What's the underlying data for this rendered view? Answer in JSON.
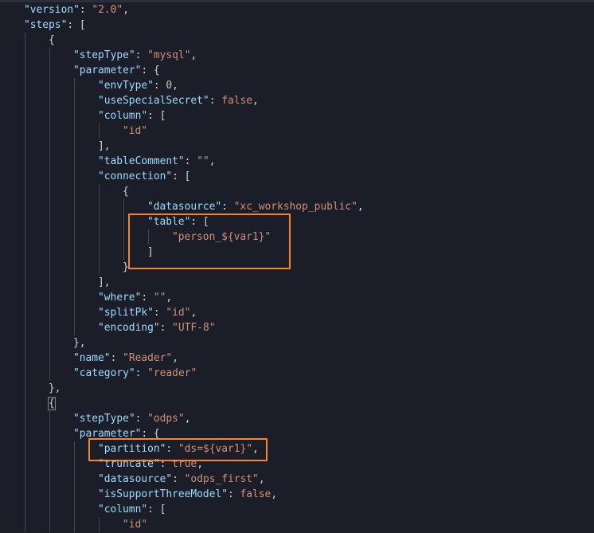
{
  "editor": {
    "lines": [
      {
        "indent": 1,
        "tokens": [
          [
            "k",
            "\"version\""
          ],
          [
            "p",
            ": "
          ],
          [
            "s",
            "\"2.0\""
          ],
          [
            "p",
            ","
          ]
        ]
      },
      {
        "indent": 1,
        "tokens": [
          [
            "k",
            "\"steps\""
          ],
          [
            "p",
            ": ["
          ]
        ]
      },
      {
        "indent": 2,
        "tokens": [
          [
            "p",
            "{"
          ]
        ]
      },
      {
        "indent": 3,
        "tokens": [
          [
            "k",
            "\"stepType\""
          ],
          [
            "p",
            ": "
          ],
          [
            "s",
            "\"mysql\""
          ],
          [
            "p",
            ","
          ]
        ]
      },
      {
        "indent": 3,
        "tokens": [
          [
            "k",
            "\"parameter\""
          ],
          [
            "p",
            ": {"
          ]
        ]
      },
      {
        "indent": 4,
        "tokens": [
          [
            "k",
            "\"envType\""
          ],
          [
            "p",
            ": "
          ],
          [
            "n",
            "0"
          ],
          [
            "p",
            ","
          ]
        ]
      },
      {
        "indent": 4,
        "tokens": [
          [
            "k",
            "\"useSpecialSecret\""
          ],
          [
            "p",
            ": "
          ],
          [
            "s",
            "false"
          ],
          [
            "p",
            ","
          ]
        ]
      },
      {
        "indent": 4,
        "tokens": [
          [
            "k",
            "\"column\""
          ],
          [
            "p",
            ": ["
          ]
        ]
      },
      {
        "indent": 5,
        "tokens": [
          [
            "s",
            "\"id\""
          ]
        ]
      },
      {
        "indent": 4,
        "tokens": [
          [
            "p",
            "],"
          ]
        ]
      },
      {
        "indent": 4,
        "tokens": [
          [
            "k",
            "\"tableComment\""
          ],
          [
            "p",
            ": "
          ],
          [
            "s",
            "\"\""
          ],
          [
            "p",
            ","
          ]
        ]
      },
      {
        "indent": 4,
        "tokens": [
          [
            "k",
            "\"connection\""
          ],
          [
            "p",
            ": ["
          ]
        ]
      },
      {
        "indent": 5,
        "tokens": [
          [
            "p",
            "{"
          ]
        ]
      },
      {
        "indent": 6,
        "tokens": [
          [
            "k",
            "\"datasource\""
          ],
          [
            "p",
            ": "
          ],
          [
            "s",
            "\"xc_workshop_public\""
          ],
          [
            "p",
            ","
          ]
        ]
      },
      {
        "indent": 6,
        "tokens": [
          [
            "k",
            "\"table\""
          ],
          [
            "p",
            ": ["
          ]
        ]
      },
      {
        "indent": 7,
        "tokens": [
          [
            "s",
            "\"person_${var1}\""
          ]
        ]
      },
      {
        "indent": 6,
        "tokens": [
          [
            "p",
            "]"
          ]
        ]
      },
      {
        "indent": 5,
        "tokens": [
          [
            "p",
            "}"
          ]
        ]
      },
      {
        "indent": 4,
        "tokens": [
          [
            "p",
            "],"
          ]
        ]
      },
      {
        "indent": 4,
        "tokens": [
          [
            "k",
            "\"where\""
          ],
          [
            "p",
            ": "
          ],
          [
            "s",
            "\"\""
          ],
          [
            "p",
            ","
          ]
        ]
      },
      {
        "indent": 4,
        "tokens": [
          [
            "k",
            "\"splitPk\""
          ],
          [
            "p",
            ": "
          ],
          [
            "s",
            "\"id\""
          ],
          [
            "p",
            ","
          ]
        ]
      },
      {
        "indent": 4,
        "tokens": [
          [
            "k",
            "\"encoding\""
          ],
          [
            "p",
            ": "
          ],
          [
            "s",
            "\"UTF-8\""
          ]
        ]
      },
      {
        "indent": 3,
        "tokens": [
          [
            "p",
            "},"
          ]
        ]
      },
      {
        "indent": 3,
        "tokens": [
          [
            "k",
            "\"name\""
          ],
          [
            "p",
            ": "
          ],
          [
            "s",
            "\"Reader\""
          ],
          [
            "p",
            ","
          ]
        ]
      },
      {
        "indent": 3,
        "tokens": [
          [
            "k",
            "\"category\""
          ],
          [
            "p",
            ": "
          ],
          [
            "s",
            "\"reader\""
          ]
        ]
      },
      {
        "indent": 2,
        "tokens": [
          [
            "p",
            "},"
          ]
        ]
      },
      {
        "indent": 2,
        "cursor": true,
        "tokens": [
          [
            "p",
            "{"
          ]
        ]
      },
      {
        "indent": 3,
        "tokens": [
          [
            "k",
            "\"stepType\""
          ],
          [
            "p",
            ": "
          ],
          [
            "s",
            "\"odps\""
          ],
          [
            "p",
            ","
          ]
        ]
      },
      {
        "indent": 3,
        "tokens": [
          [
            "k",
            "\"parameter\""
          ],
          [
            "p",
            ": {"
          ]
        ]
      },
      {
        "indent": 4,
        "tokens": [
          [
            "k",
            "\"partition\""
          ],
          [
            "p",
            ": "
          ],
          [
            "s",
            "\"ds=${var1}\""
          ],
          [
            "p",
            ","
          ]
        ]
      },
      {
        "indent": 4,
        "tokens": [
          [
            "k",
            "\"truncate\""
          ],
          [
            "p",
            ": "
          ],
          [
            "s",
            "true"
          ],
          [
            "p",
            ","
          ]
        ]
      },
      {
        "indent": 4,
        "tokens": [
          [
            "k",
            "\"datasource\""
          ],
          [
            "p",
            ": "
          ],
          [
            "s",
            "\"odps_first\""
          ],
          [
            "p",
            ","
          ]
        ]
      },
      {
        "indent": 4,
        "tokens": [
          [
            "k",
            "\"isSupportThreeModel\""
          ],
          [
            "p",
            ": "
          ],
          [
            "s",
            "false"
          ],
          [
            "p",
            ","
          ]
        ]
      },
      {
        "indent": 4,
        "tokens": [
          [
            "k",
            "\"column\""
          ],
          [
            "p",
            ": ["
          ]
        ]
      },
      {
        "indent": 5,
        "tokens": [
          [
            "s",
            "\"id\""
          ]
        ]
      }
    ]
  },
  "colors": {
    "highlight": "#f5862b",
    "background": "#1b1d29"
  }
}
